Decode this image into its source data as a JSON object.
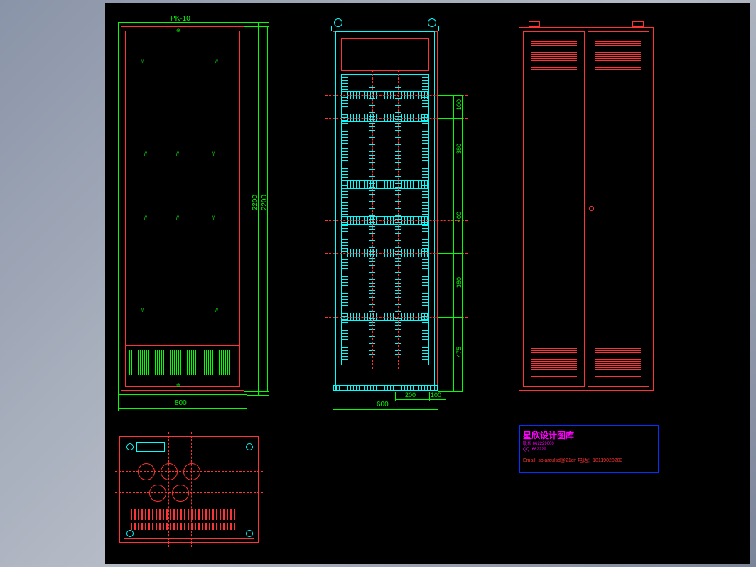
{
  "drawing_label": "PK-10",
  "dimensions": {
    "front_width": "800",
    "front_height_outer": "2200",
    "front_height_inner": "2200",
    "side_width": "600",
    "side_seg1": "200",
    "side_seg2": "100",
    "side_h1": "100",
    "side_h2": "380",
    "side_h3": "400",
    "side_h4": "380",
    "side_h5": "475"
  },
  "title_block": {
    "title": "星欣设计图库",
    "line1": "联系 662229000",
    "line2": "QQ: 662229",
    "footer": "Email: solarculsd@21cn 电话：18119020203"
  },
  "chart_data": {
    "type": "engineering_drawing",
    "views": [
      {
        "name": "front",
        "width_mm": 800,
        "height_mm": 2200,
        "label": "PK-10"
      },
      {
        "name": "side_internal",
        "width_mm": 600,
        "sub_widths_mm": [
          200,
          100
        ],
        "vertical_segments_mm": [
          100,
          380,
          400,
          380,
          475
        ]
      },
      {
        "name": "rear",
        "type": "double_door_with_vents"
      },
      {
        "name": "top",
        "type": "plan_view_with_cutouts"
      }
    ],
    "colors": {
      "outline": "#ff3333",
      "dimension": "#00ff00",
      "construction": "#00ffff",
      "centerline": "#ff3333"
    }
  }
}
